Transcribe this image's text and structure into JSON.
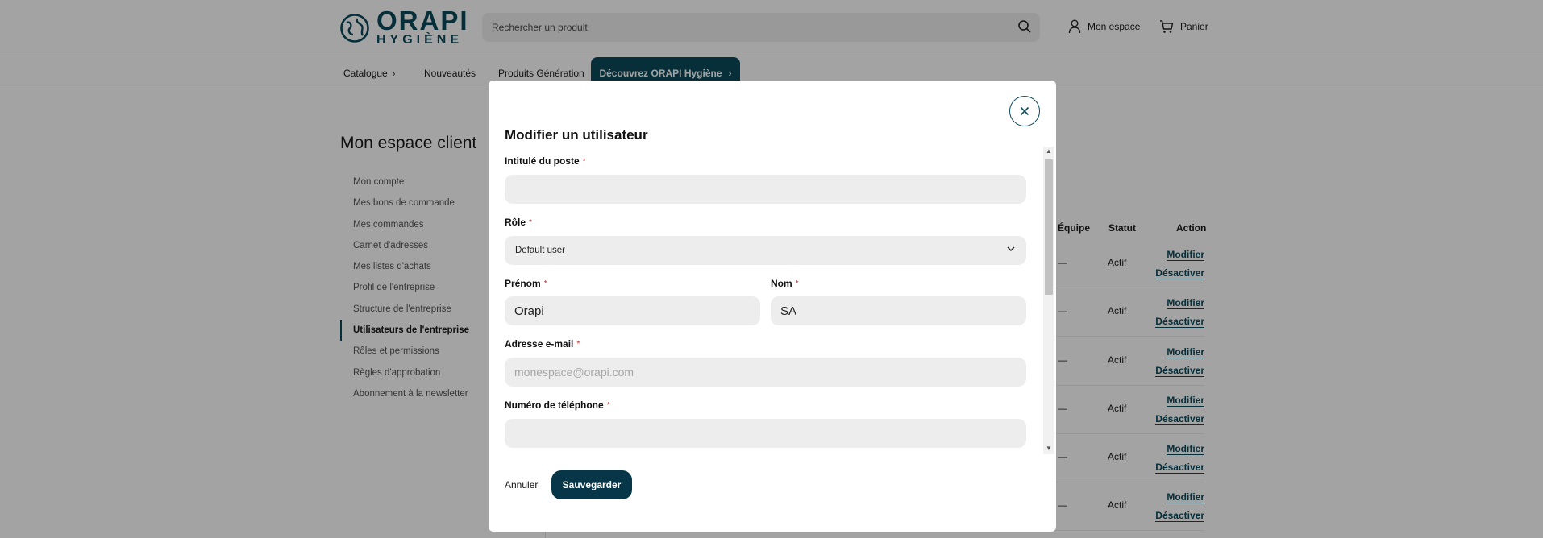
{
  "header": {
    "logo_main": "ORAPI",
    "logo_sub": "HYGIÈNE",
    "search_placeholder": "Rechercher un produit",
    "account_label": "Mon espace",
    "cart_label": "Panier"
  },
  "nav": {
    "items": [
      "Catalogue",
      "Nouveautés",
      "Produits Génération"
    ],
    "discover_label": "Découvrez ORAPI Hygiène",
    "chevron": "›"
  },
  "page": {
    "title": "Mon espace client",
    "menu": [
      "Mon compte",
      "Mes bons de commande",
      "Mes commandes",
      "Carnet d'adresses",
      "Mes listes d'achats",
      "Profil de l'entreprise",
      "Structure de l'entreprise",
      "Utilisateurs de l'entreprise",
      "Rôles et permissions",
      "Règles d'approbation",
      "Abonnement à la newsletter"
    ],
    "active_menu_index": 7
  },
  "table": {
    "headers": {
      "team": "Équipe",
      "status": "Statut",
      "action": "Action"
    },
    "rows": [
      {
        "team": "—",
        "status": "Actif",
        "edit": "Modifier",
        "deactivate": "Désactiver"
      },
      {
        "team": "—",
        "status": "Actif",
        "edit": "Modifier",
        "deactivate": "Désactiver"
      },
      {
        "team": "—",
        "status": "Actif",
        "edit": "Modifier",
        "deactivate": "Désactiver"
      },
      {
        "team": "—",
        "status": "Actif",
        "edit": "Modifier",
        "deactivate": "Désactiver"
      },
      {
        "team": "—",
        "status": "Actif",
        "edit": "Modifier",
        "deactivate": "Désactiver"
      },
      {
        "team": "—",
        "status": "Actif",
        "edit": "Modifier",
        "deactivate": "Désactiver"
      }
    ]
  },
  "modal": {
    "title": "Modifier un utilisateur",
    "required_mark": "*",
    "fields": {
      "job_title": {
        "label": "Intitulé du poste",
        "value": ""
      },
      "role": {
        "label": "Rôle",
        "value": "Default user"
      },
      "first_name": {
        "label": "Prénom",
        "value": "Orapi"
      },
      "last_name": {
        "label": "Nom",
        "value": "SA"
      },
      "email": {
        "label": "Adresse e-mail",
        "value": "",
        "placeholder": "monespace@orapi.com"
      },
      "phone": {
        "label": "Numéro de téléphone",
        "value": ""
      }
    },
    "cancel_label": "Annuler",
    "save_label": "Sauvegarder"
  },
  "colors": {
    "brand": "#0c4a5c",
    "save_button": "#063647",
    "required": "#c22f2f"
  }
}
